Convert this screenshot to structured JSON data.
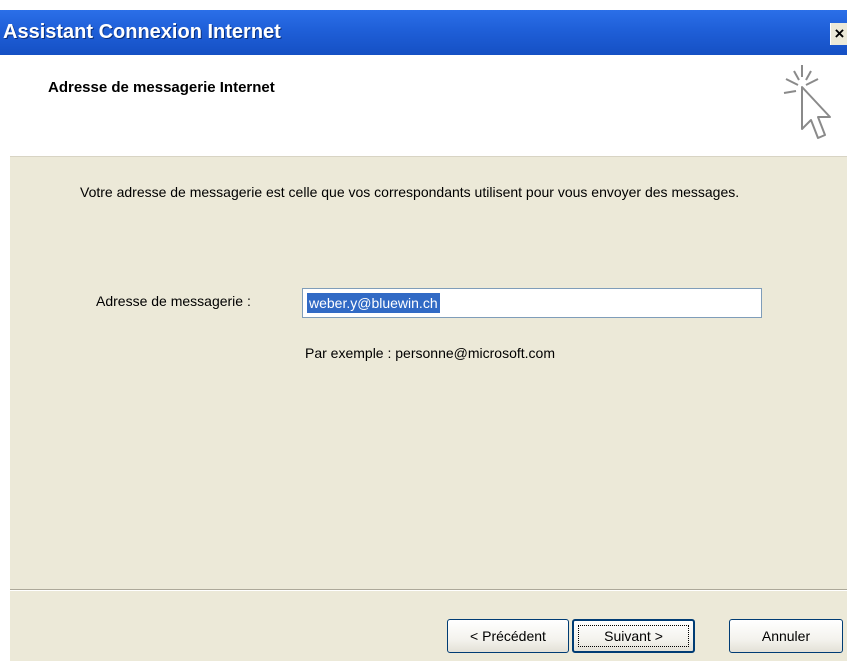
{
  "window": {
    "title": "Assistant Connexion Internet",
    "close_label": "×"
  },
  "header": {
    "title": "Adresse de messagerie Internet",
    "icon": "wizard-cursor-icon"
  },
  "content": {
    "description": "Votre adresse de messagerie est celle que vos correspondants utilisent pour vous envoyer des messages.",
    "email_label": "Adresse de messagerie :",
    "email_value": "weber.y@bluewin.ch",
    "example": "Par exemple : personne@microsoft.com"
  },
  "buttons": {
    "back": "< Précédent",
    "next": "Suivant >",
    "cancel": "Annuler"
  },
  "colors": {
    "titlebar": "#1f5fd8",
    "panel": "#ece9d8",
    "selection": "#316ac5"
  }
}
